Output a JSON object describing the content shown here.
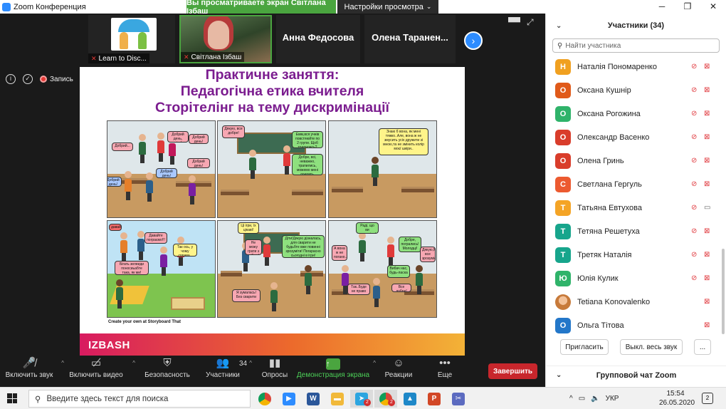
{
  "window": {
    "title": "Zoom Конференция",
    "controls": [
      "─",
      "❐",
      "✕"
    ]
  },
  "share_banner": "Вы просматриваете экран Світлана Ізбаш",
  "view_options": "Настройки просмотра",
  "video_strip": {
    "tiles": [
      {
        "caption": "Learn to Disc..."
      },
      {
        "caption": "Світлана Ізбаш"
      },
      {
        "name": "Анна Федосова"
      },
      {
        "name": "Олена  Таранен..."
      }
    ],
    "next_icon": "chevron-right-icon"
  },
  "recording_label": "Запись",
  "slide": {
    "title_lines": [
      "Практичне заняття:",
      "Педагогічна етика вчителя",
      "Сторітелінг на тему дискримінації"
    ],
    "credit": "Create your own at Storyboard That",
    "brand": "IZBASH",
    "bubbles": {
      "p1": [
        "Добрий день, діти!",
        "Добрий день!",
        "Добрий...",
        "Добрий день!",
        "Добрий день!",
        "Добрий день!"
      ],
      "p2": [
        "Дякую, все добре!",
        "Емм,вся учнів повстяюйте по 2 групи. Щоб трапились?",
        "Добре, всі, неважно, трапились, можемо мені доерять."
      ],
      "p3": [
        "Знаю б вона, як мені тяжко..Але, вона ж не змусить усіх дружити зі мною,та не змінить колір моєї шкіри.."
      ],
      "p4": [
        "давай!",
        "Давайте пограємо!!!",
        "Так ось, у чому справа..",
        "Бігать зелеиди поносиьабте така, як ми!"
      ],
      "p5": [
        "Ці ігри, їх цікаві!",
        "Не можу грати з тобою!",
        "Діти!Дякую дізналась, для сварити не будьбте вже повинні зрозуміти! Погарасно сьогодні в ігри!",
        "Я зумалась!Без сварити"
      ],
      "p6": [
        "Раді, що ви зрозуміли!",
        "Добре, погрались! Молодці!",
        "Дякую,М все зрозуміла!",
        "Вибач нас, будь-ласка",
        "Так..Буде не право",
        "Все добре!",
        "А вона ж не погано.."
      ]
    }
  },
  "toolbar": {
    "mute": "Включить звук",
    "video": "Включить видео",
    "security": "Безопасность",
    "participants": "Участники",
    "participants_count": "34",
    "polls": "Опросы",
    "share": "Демонстрация экрана",
    "reactions": "Реакции",
    "more": "Еще",
    "leave": "Завершить"
  },
  "participants_panel": {
    "title": "Участники (34)",
    "search_placeholder": "Найти участника",
    "people": [
      {
        "initial": "Н",
        "name": "Наталія Пономаренко",
        "color": "#f0a020",
        "video": "off"
      },
      {
        "initial": "О",
        "name": "Оксана Кушнір",
        "color": "#e05a1a",
        "video": "off"
      },
      {
        "initial": "О",
        "name": "Оксана Рогожина",
        "color": "#2fb36a",
        "video": "off"
      },
      {
        "initial": "О",
        "name": "Олександр Васенко",
        "color": "#d93d2b",
        "video": "off"
      },
      {
        "initial": "О",
        "name": "Олена Гринь",
        "color": "#d93d2b",
        "video": "off"
      },
      {
        "initial": "С",
        "name": "Светлана Гергуль",
        "color": "#ec5a30",
        "video": "off"
      },
      {
        "initial": "Т",
        "name": "Татьяна Евтухова",
        "color": "#f4a426",
        "video": "on"
      },
      {
        "initial": "Т",
        "name": "Тетяна Решетуха",
        "color": "#17a58c",
        "video": "off"
      },
      {
        "initial": "Т",
        "name": "Третяк Наталія",
        "color": "#17a58c",
        "video": "off"
      },
      {
        "initial": "Ю",
        "name": "Юлія Кулик",
        "color": "#2fb36a",
        "video": "off"
      },
      {
        "initial": "",
        "name": "Tetiana Konovalenko",
        "color": "#c77a3a",
        "video": "off",
        "mic_hidden": true
      },
      {
        "initial": "О",
        "name": "Ольга Тітова",
        "color": "#2377c9",
        "video": "off",
        "mic_hidden": true
      }
    ],
    "invite": "Пригласить",
    "mute_all": "Выкл. весь звук",
    "more": "...",
    "chat_title": "Групповой чат Zoom"
  },
  "taskbar": {
    "search_placeholder": "Введите здесь текст для поиска",
    "lang": "УКР",
    "time": "15:54",
    "date": "26.05.2020",
    "notif_count": "2",
    "chrome_badge": "2",
    "apps": [
      {
        "name": "chrome-icon",
        "label": "",
        "color": "#db4437"
      },
      {
        "name": "zoom-icon",
        "label": "▶",
        "color": "#2d8cff"
      },
      {
        "name": "word-icon",
        "label": "W",
        "color": "#2b579a"
      },
      {
        "name": "explorer-icon",
        "label": "▬",
        "color": "#f1b93a"
      },
      {
        "name": "telegram-icon",
        "label": "➤",
        "color": "#2ca5e0"
      },
      {
        "name": "chrome2-icon",
        "label": "",
        "color": "#0f9d58"
      },
      {
        "name": "photos-icon",
        "label": "▲",
        "color": "#1e88c8"
      },
      {
        "name": "powerpoint-icon",
        "label": "P",
        "color": "#d24726"
      },
      {
        "name": "snip-icon",
        "label": "✂",
        "color": "#5c6bc0"
      }
    ]
  }
}
